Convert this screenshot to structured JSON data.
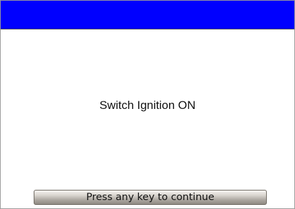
{
  "header": {
    "title": "",
    "color": "#0000ff"
  },
  "main": {
    "message": "Switch Ignition ON"
  },
  "footer": {
    "continue_label": "Press any key to continue"
  }
}
